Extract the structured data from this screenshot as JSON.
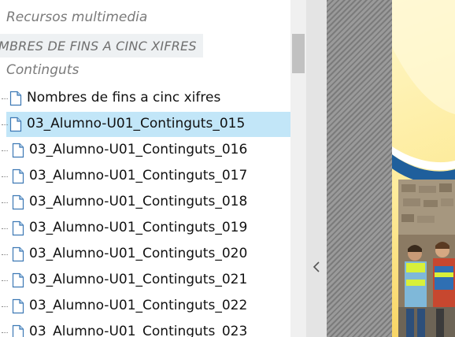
{
  "tree": {
    "section_resources": "Recursos multimedia",
    "banner_title": "MBRES DE FINS A CINC XIFRES",
    "section_contents": "Continguts",
    "items": [
      {
        "label": "Nombres de fins a cinc xifres",
        "selected": false
      },
      {
        "label": "03_Alumno-U01_Continguts_015",
        "selected": true
      },
      {
        "label": "03_Alumno-U01_Continguts_016",
        "selected": false
      },
      {
        "label": "03_Alumno-U01_Continguts_017",
        "selected": false
      },
      {
        "label": "03_Alumno-U01_Continguts_018",
        "selected": false
      },
      {
        "label": "03_Alumno-U01_Continguts_019",
        "selected": false
      },
      {
        "label": "03_Alumno-U01_Continguts_020",
        "selected": false
      },
      {
        "label": "03_Alumno-U01_Continguts_021",
        "selected": false
      },
      {
        "label": "03_Alumno-U01_Continguts_022",
        "selected": false
      },
      {
        "label": "03_Alumno-U01_Continguts_023",
        "selected": false
      }
    ]
  },
  "icons": {
    "document": "document-icon",
    "collapse": "chevron-left-icon"
  },
  "colors": {
    "selection": "#c2e6f8",
    "section_text": "#7a7a7a",
    "banner_bg": "#eef1f3"
  }
}
